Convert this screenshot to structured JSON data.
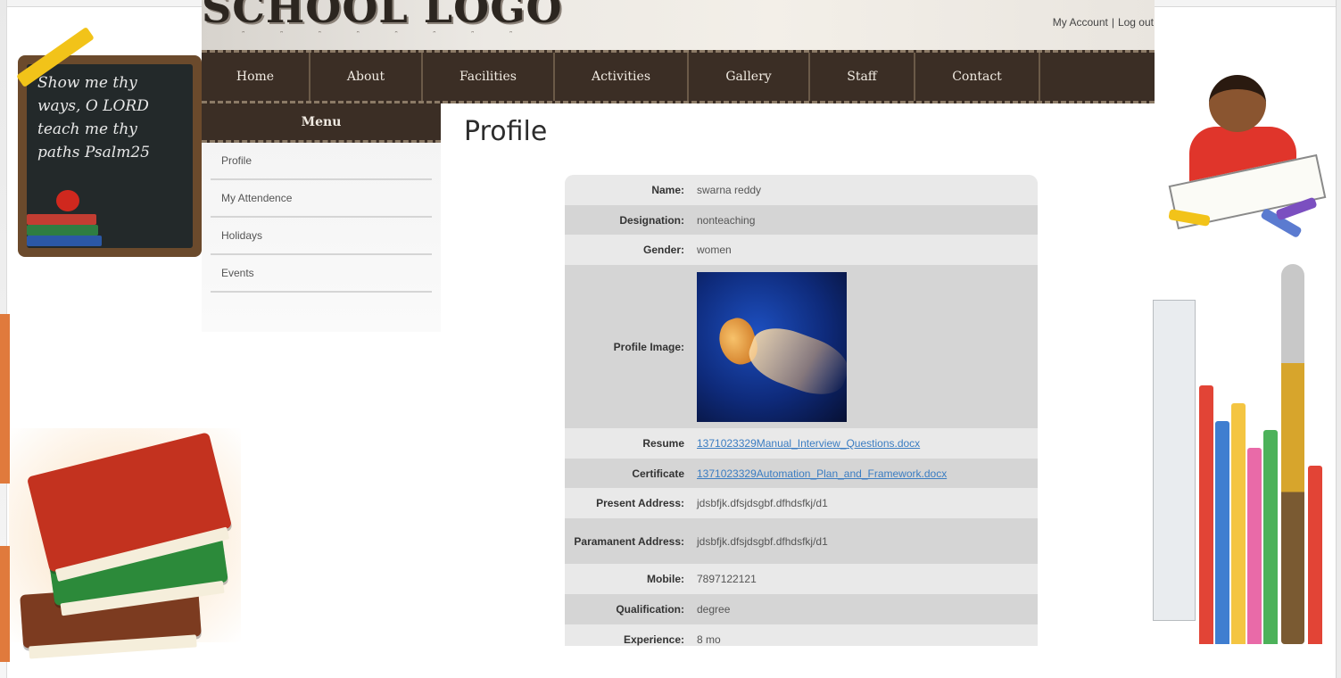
{
  "header": {
    "logo_text": "SCHOOL LOGO",
    "logo_dots": "ᵔ ᵔ ᵔ ᵔ ᵔ ᵔ ᵔ ᵔ",
    "my_account": "My Account",
    "separator": "|",
    "log_out": "Log out"
  },
  "nav": {
    "items": [
      {
        "label": "Home"
      },
      {
        "label": "About"
      },
      {
        "label": "Facilities"
      },
      {
        "label": "Activities"
      },
      {
        "label": "Gallery"
      },
      {
        "label": "Staff"
      },
      {
        "label": "Contact"
      }
    ]
  },
  "decor": {
    "chalkboard_text": "Show me thy ways, O LORD teach me thy paths Psalm25"
  },
  "menu": {
    "title": "Menu",
    "items": [
      {
        "label": "Profile"
      },
      {
        "label": "My Attendence"
      },
      {
        "label": "Holidays"
      },
      {
        "label": "Events"
      }
    ]
  },
  "page": {
    "title": "Profile"
  },
  "profile": {
    "name_label": "Name:",
    "name": "swarna reddy",
    "designation_label": "Designation:",
    "designation": "nonteaching",
    "gender_label": "Gender:",
    "gender": "women",
    "image_label": "Profile Image:",
    "resume_label": "Resume",
    "resume_file": "1371023329Manual_Interview_Questions.docx",
    "certificate_label": "Certificate",
    "certificate_file": "1371023329Automation_Plan_and_Framework.docx",
    "present_address_label": "Present Address:",
    "present_address": "jdsbfjk.dfsjdsgbf.dfhdsfkj/d1",
    "permanent_address_label": "Paramanent Address:",
    "permanent_address": "jdsbfjk.dfsjdsgbf.dfhdsfkj/d1",
    "mobile_label": "Mobile:",
    "mobile": "7897122121",
    "qualification_label": "Qualification:",
    "qualification": "degree",
    "experience_label": "Experience:",
    "experience": "8 mo"
  },
  "colors": {
    "nav_bg": "#3b2e25",
    "link": "#3b7dc2",
    "row_alt": "#d5d5d5"
  },
  "icons": {
    "profile_image": "jellyfish-photo"
  }
}
